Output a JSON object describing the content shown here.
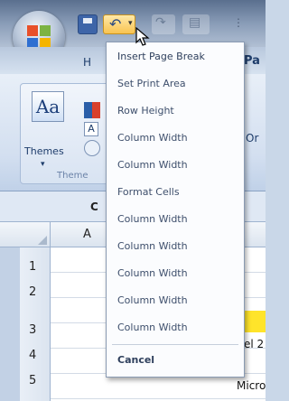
{
  "ribbon": {
    "tab_home_fragment": "H",
    "tab_page_layout_fragment": "Pa",
    "themes_label": "Themes",
    "themes_group_label": "Theme",
    "right_group_label_fragment": "Or"
  },
  "worksheet": {
    "name_box": "C",
    "column_header": "A",
    "rows": [
      "1",
      "2",
      "3",
      "4",
      "5"
    ],
    "cell_texts": [
      "el 2",
      "Micro"
    ]
  },
  "menu": {
    "items": [
      "Insert Page Break",
      "Set Print Area",
      "Row Height",
      "Column Width",
      "Column Width",
      "Format Cells",
      "Column Width",
      "Column Width",
      "Column Width",
      "Column Width",
      "Column Width",
      "Cancel"
    ]
  },
  "colors": {
    "accent_yellow": "#ffe42a",
    "menu_text": "#3e4f6c",
    "ribbon_blue": "#d3dff0"
  }
}
